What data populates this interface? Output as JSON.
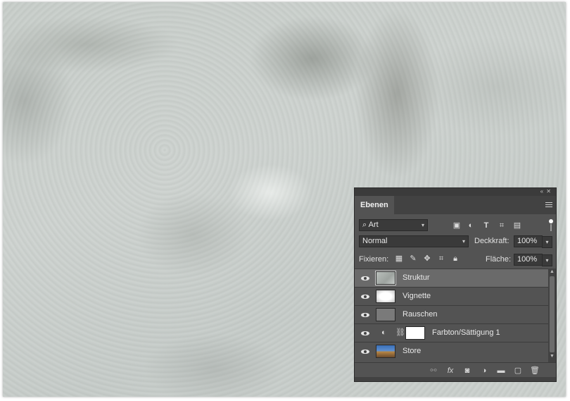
{
  "panel": {
    "tab_label": "Ebenen",
    "collapse_glyph": "«  ✕",
    "filter": {
      "label": "Art",
      "search_icon": "⌕"
    },
    "blend_mode": "Normal",
    "opacity_label": "Deckkraft:",
    "opacity_value": "100%",
    "lock_label": "Fixieren:",
    "fill_label": "Fläche:",
    "fill_value": "100%",
    "layers": [
      {
        "name": "Struktur",
        "selected": true
      },
      {
        "name": "Vignette",
        "selected": false
      },
      {
        "name": "Rauschen",
        "selected": false
      },
      {
        "name": "Farbton/Sättigung 1",
        "selected": false,
        "adjustment": true
      },
      {
        "name": "Store",
        "selected": false
      }
    ]
  },
  "icons": {
    "filter_icons": [
      "image-filter-icon",
      "adjustment-filter-icon",
      "type-filter-icon",
      "shape-filter-icon",
      "smartobject-filter-icon"
    ],
    "lock_icons": [
      "lock-transparency-icon",
      "lock-paint-icon",
      "lock-position-icon",
      "lock-artboard-icon",
      "lock-all-icon"
    ],
    "bottom_icons": [
      "link-icon",
      "fx-icon",
      "mask-icon",
      "adjustment-icon",
      "folder-icon",
      "new-layer-icon",
      "trash-icon"
    ]
  },
  "colors": {
    "panel_bg": "#535353",
    "selected_row": "#6a6a6a",
    "canvas_texture": "#cbd0cd"
  }
}
